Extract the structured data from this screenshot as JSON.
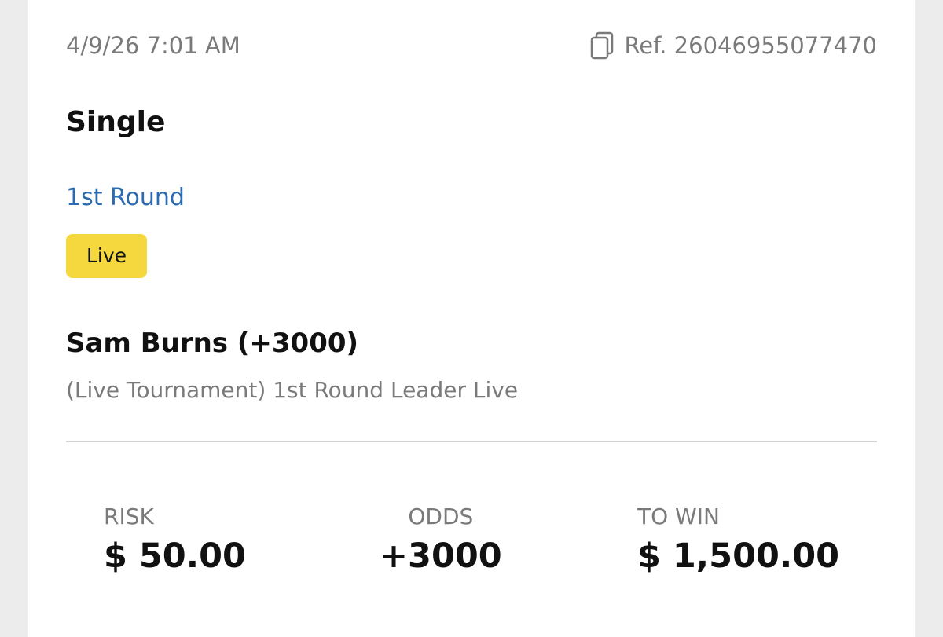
{
  "bet": {
    "datetime": "4/9/26 7:01 AM",
    "ref_label": "Ref. 26046955077470",
    "type": "Single",
    "event": "1st Round",
    "status_badge": "Live",
    "selection": "Sam Burns (+3000)",
    "market": "(Live Tournament) 1st Round Leader Live"
  },
  "summary": {
    "risk_label": "RISK",
    "risk_value": "$ 50.00",
    "odds_label": "ODDS",
    "odds_value": "+3000",
    "towin_label": "TO WIN",
    "towin_value": "$ 1,500.00"
  },
  "icons": {
    "copy": "copy-icon"
  },
  "colors": {
    "background": "#ececec",
    "card": "#ffffff",
    "link": "#2b6cb0",
    "live_badge": "#f5d83d",
    "muted_text": "#7a7a7a",
    "primary_text": "#111111"
  }
}
